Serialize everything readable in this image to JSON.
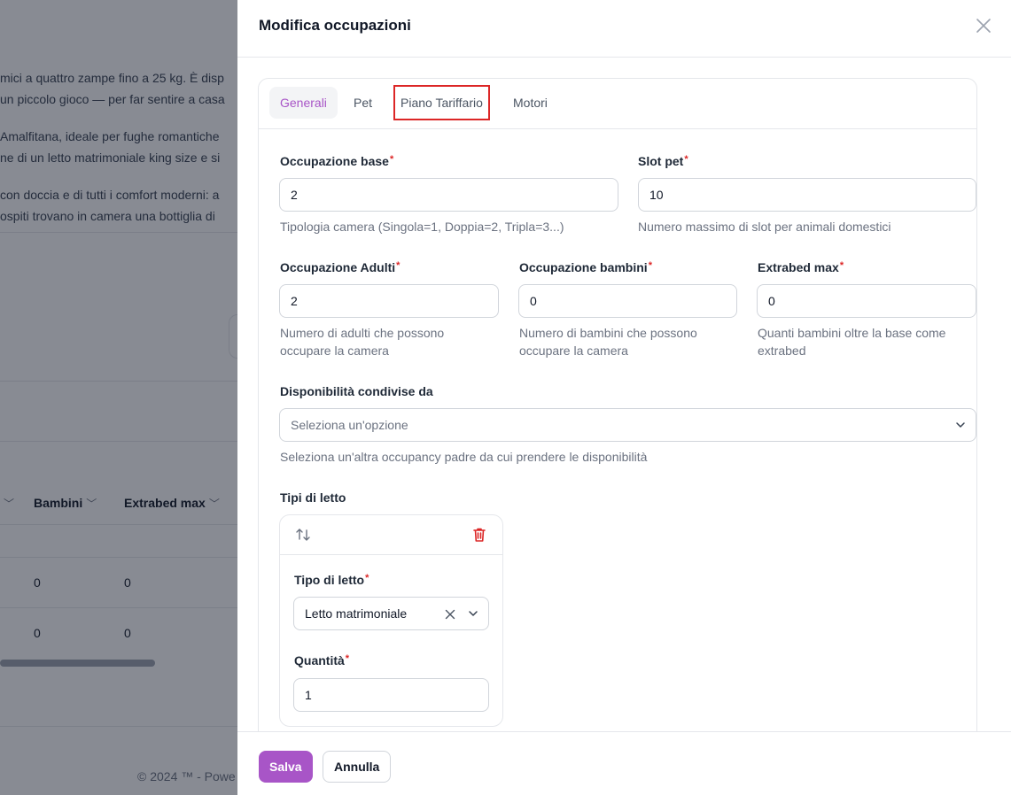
{
  "background": {
    "lines": [
      "mici a quattro zampe fino a 25 kg. È disp",
      "un piccolo gioco — per far sentire a casa",
      "Amalfitana, ideale per fughe romantiche",
      "ne di un letto matrimoniale king size e si",
      "con doccia e di tutti i comfort moderni: a",
      " ospiti trovano in camera una bottiglia di"
    ],
    "table": {
      "headers": [
        "Bambini",
        "Extrabed max"
      ],
      "rows": [
        [
          "0",
          "0"
        ],
        [
          "0",
          "0"
        ]
      ]
    },
    "footer": "© 2024 ™ - Powe"
  },
  "drawer": {
    "title": "Modifica occupazioni",
    "tabs": [
      {
        "label": "Generali"
      },
      {
        "label": "Pet"
      },
      {
        "label": "Piano Tariffario"
      },
      {
        "label": "Motori"
      }
    ],
    "fields": {
      "occupazione_base": {
        "label": "Occupazione base",
        "value": "2",
        "help": "Tipologia camera (Singola=1, Doppia=2, Tripla=3...)"
      },
      "slot_pet": {
        "label": "Slot pet",
        "value": "10",
        "help": "Numero massimo di slot per animali domestici"
      },
      "occupazione_adulti": {
        "label": "Occupazione Adulti",
        "value": "2",
        "help": "Numero di adulti che possono occupare la camera"
      },
      "occupazione_bambini": {
        "label": "Occupazione bambini",
        "value": "0",
        "help": "Numero di bambini che possono occupare la camera"
      },
      "extrabed_max": {
        "label": "Extrabed max",
        "value": "0",
        "help": "Quanti bambini oltre la base come extrabed"
      },
      "disponibilita": {
        "label": "Disponibilità condivise da",
        "placeholder": "Seleziona un'opzione",
        "help": "Seleziona un'altra occupancy padre da cui prendere le disponibilità"
      }
    },
    "beds": {
      "label": "Tipi di letto",
      "item": {
        "tipo_label": "Tipo di letto",
        "tipo_value": "Letto matrimoniale",
        "quantita_label": "Quantità",
        "quantita_value": "1"
      }
    },
    "required_mark": "*",
    "buttons": {
      "save": "Salva",
      "cancel": "Annulla"
    }
  },
  "colors": {
    "accent": "#a855c7",
    "danger": "#dc2626",
    "highlight": "#dc2626"
  }
}
